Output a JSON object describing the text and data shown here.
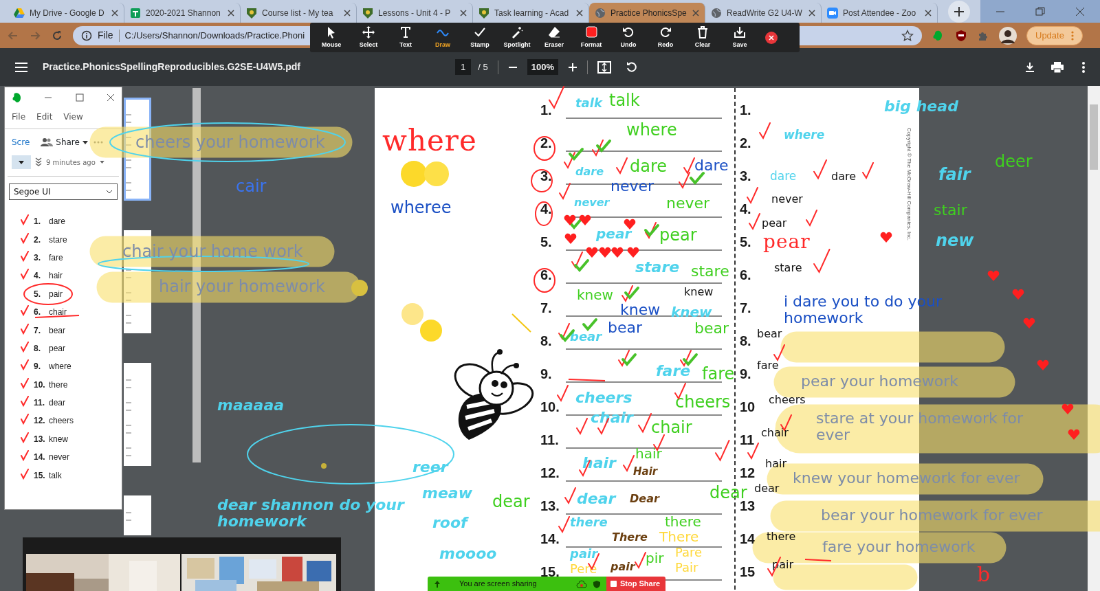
{
  "browser": {
    "tabs": [
      {
        "title": "My Drive - Google D",
        "selected": false
      },
      {
        "title": "2020-2021 Shannon",
        "selected": false
      },
      {
        "title": "Course list - My tea",
        "selected": false
      },
      {
        "title": "Lessons - Unit 4 - P",
        "selected": false
      },
      {
        "title": "Task learning - Acad",
        "selected": false
      },
      {
        "title": "Practice PhonicsSpe",
        "selected": true
      },
      {
        "title": "ReadWrite G2 U4-W",
        "selected": false
      },
      {
        "title": "Post Attendee - Zoo",
        "selected": false
      }
    ],
    "address": {
      "scheme": "File",
      "url": "C:/Users/Shannon/Downloads/Practice.Phoni"
    },
    "update_button": "Update"
  },
  "annotation_toolbar": {
    "tools": [
      {
        "label": "Mouse",
        "selected": false
      },
      {
        "label": "Select",
        "selected": false
      },
      {
        "label": "Text",
        "selected": false
      },
      {
        "label": "Draw",
        "selected": true
      },
      {
        "label": "Stamp",
        "selected": false
      },
      {
        "label": "Spotlight",
        "selected": false
      },
      {
        "label": "Eraser",
        "selected": false
      },
      {
        "label": "Format",
        "selected": false
      },
      {
        "label": "Undo",
        "selected": false
      },
      {
        "label": "Redo",
        "selected": false
      },
      {
        "label": "Clear",
        "selected": false
      },
      {
        "label": "Save",
        "selected": false
      }
    ]
  },
  "pdf_viewer": {
    "file_name": "Practice.PhonicsSpellingReproducibles.G2SE-U4W5.pdf",
    "page": "1",
    "page_count": "/ 5",
    "zoom": "100%",
    "page_thumbnails": [
      {
        "selected": true
      },
      {
        "selected": false
      },
      {
        "selected": false
      },
      {
        "selected": false
      }
    ]
  },
  "note_window": {
    "menu": [
      "File",
      "Edit",
      "View"
    ],
    "toolbar_button": "Scre",
    "share_button": "Share",
    "updated": "9 minutes ago",
    "font": "Segoe UI",
    "words": [
      {
        "number": "1.",
        "word": "dare"
      },
      {
        "number": "2.",
        "word": "stare"
      },
      {
        "number": "3.",
        "word": "fare"
      },
      {
        "number": "4.",
        "word": "hair"
      },
      {
        "number": "5.",
        "word": "pair"
      },
      {
        "number": "6.",
        "word": "chair"
      },
      {
        "number": "7.",
        "word": "bear"
      },
      {
        "number": "8.",
        "word": "pear"
      },
      {
        "number": "9.",
        "word": "where"
      },
      {
        "number": "10.",
        "word": "there"
      },
      {
        "number": "11.",
        "word": "dear"
      },
      {
        "number": "12.",
        "word": "cheers"
      },
      {
        "number": "13.",
        "word": "knew"
      },
      {
        "number": "14.",
        "word": "never"
      },
      {
        "number": "15.",
        "word": "talk"
      }
    ]
  },
  "worksheet": {
    "left_numbers": [
      "1.",
      "2.",
      "3.",
      "4.",
      "5.",
      "6.",
      "7.",
      "8.",
      "9.",
      "10.",
      "11.",
      "12.",
      "13.",
      "14.",
      "15."
    ],
    "right_numbers": [
      "1.",
      "2.",
      "3.",
      "4.",
      "5.",
      "6.",
      "7.",
      "8.",
      "9.",
      "10",
      "11",
      "12",
      "13",
      "14",
      "15"
    ],
    "copyright": "Copyright © The McGraw-Hill Companies, Inc."
  },
  "annotations": [
    {
      "text": "cheers your homework",
      "kind": "typed",
      "color": "#7d8ca8"
    },
    {
      "text": "where",
      "kind": "ink",
      "color": "#ff2a2a"
    },
    {
      "text": "cair",
      "kind": "typed",
      "color": "#3a74f0"
    },
    {
      "text": "wheree",
      "kind": "typed",
      "color": "#1a4fc4"
    },
    {
      "text": "chair your home work",
      "kind": "typed",
      "color": "#7d8ca8"
    },
    {
      "text": "hair your homework",
      "kind": "typed",
      "color": "#7d8ca8"
    },
    {
      "text": "maaaaa",
      "kind": "bold-italic",
      "color": "#4fd3ec"
    },
    {
      "text": "dear shannon do your homework",
      "kind": "bold-italic",
      "color": "#4fd3ec"
    },
    {
      "text": "reer",
      "kind": "bold-italic",
      "color": "#4fd3ec"
    },
    {
      "text": "meaw",
      "kind": "bold-italic",
      "color": "#4fd3ec"
    },
    {
      "text": "dear",
      "kind": "typed",
      "color": "#3fcf1f"
    },
    {
      "text": "roof",
      "kind": "bold-italic",
      "color": "#4fd3ec"
    },
    {
      "text": "moooo",
      "kind": "bold-italic",
      "color": "#4fd3ec"
    },
    {
      "text": "talk",
      "kind": "bold-italic",
      "color": "#4fd3ec"
    },
    {
      "text": "talk",
      "kind": "typed",
      "color": "#3fcf1f"
    },
    {
      "text": "where",
      "kind": "typed",
      "color": "#3fcf1f"
    },
    {
      "text": "dare",
      "kind": "bold-italic",
      "color": "#4fd3ec"
    },
    {
      "text": "dare",
      "kind": "typed",
      "color": "#3fcf1f"
    },
    {
      "text": "dare",
      "kind": "typed",
      "color": "#1a4fc4"
    },
    {
      "text": "never",
      "kind": "typed",
      "color": "#1a4fc4"
    },
    {
      "text": "never",
      "kind": "bold-italic",
      "color": "#4fd3ec"
    },
    {
      "text": "never",
      "kind": "typed",
      "color": "#3fcf1f"
    },
    {
      "text": "pear",
      "kind": "bold-italic",
      "color": "#4fd3ec"
    },
    {
      "text": "pear",
      "kind": "typed",
      "color": "#3fcf1f"
    },
    {
      "text": "stare",
      "kind": "bold-italic",
      "color": "#4fd3ec"
    },
    {
      "text": "stare",
      "kind": "typed",
      "color": "#3fcf1f"
    },
    {
      "text": "knew",
      "kind": "typed",
      "color": "#3fcf1f"
    },
    {
      "text": "knew",
      "kind": "typed",
      "color": "#1a4fc4"
    },
    {
      "text": "knew",
      "kind": "typed",
      "color": "#111111"
    },
    {
      "text": "knew",
      "kind": "bold-italic",
      "color": "#4fd3ec"
    },
    {
      "text": "bear",
      "kind": "typed",
      "color": "#1a4fc4"
    },
    {
      "text": "bear",
      "kind": "typed",
      "color": "#3fcf1f"
    },
    {
      "text": "bear",
      "kind": "bold-italic",
      "color": "#4fd3ec"
    },
    {
      "text": "fare",
      "kind": "bold-italic",
      "color": "#4fd3ec"
    },
    {
      "text": "fare",
      "kind": "typed",
      "color": "#3fcf1f"
    },
    {
      "text": "cheers",
      "kind": "bold-italic",
      "color": "#4fd3ec"
    },
    {
      "text": "cheers",
      "kind": "typed",
      "color": "#3fcf1f"
    },
    {
      "text": "chair",
      "kind": "bold-italic",
      "color": "#4fd3ec"
    },
    {
      "text": "chair",
      "kind": "typed",
      "color": "#3fcf1f"
    },
    {
      "text": "hair",
      "kind": "bold-italic",
      "color": "#4fd3ec"
    },
    {
      "text": "hair",
      "kind": "typed",
      "color": "#3fcf1f"
    },
    {
      "text": "Hair",
      "kind": "bold-italic",
      "color": "#6b3f10"
    },
    {
      "text": "dear",
      "kind": "bold-italic",
      "color": "#4fd3ec"
    },
    {
      "text": "Dear",
      "kind": "bold-italic",
      "color": "#6b3f10"
    },
    {
      "text": "dear",
      "kind": "typed",
      "color": "#3fcf1f"
    },
    {
      "text": "there",
      "kind": "bold-italic",
      "color": "#4fd3ec"
    },
    {
      "text": "There",
      "kind": "bold-italic",
      "color": "#6b3f10"
    },
    {
      "text": "there",
      "kind": "typed",
      "color": "#3fcf1f"
    },
    {
      "text": "There",
      "kind": "typed",
      "color": "#ffd83a"
    },
    {
      "text": "pair",
      "kind": "bold-italic",
      "color": "#4fd3ec"
    },
    {
      "text": "Pere",
      "kind": "typed",
      "color": "#ffd83a"
    },
    {
      "text": "pair",
      "kind": "bold-italic",
      "color": "#6b3f10"
    },
    {
      "text": "pir",
      "kind": "typed",
      "color": "#3fcf1f"
    },
    {
      "text": "Pare",
      "kind": "typed",
      "color": "#ffd83a"
    },
    {
      "text": "Pair",
      "kind": "typed",
      "color": "#ffd83a"
    },
    {
      "text": "big head",
      "kind": "bold-italic",
      "color": "#4fd3ec"
    },
    {
      "text": "where",
      "kind": "bold-italic",
      "color": "#4fd3ec"
    },
    {
      "text": "dare",
      "kind": "typed",
      "color": "#4fd3ec"
    },
    {
      "text": "dare",
      "kind": "typed",
      "color": "#111111"
    },
    {
      "text": "never",
      "kind": "typed",
      "color": "#111111"
    },
    {
      "text": "pear",
      "kind": "typed",
      "color": "#111111"
    },
    {
      "text": "pear",
      "kind": "ink",
      "color": "#ff2a2a"
    },
    {
      "text": "stare",
      "kind": "typed",
      "color": "#111111"
    },
    {
      "text": "i dare you to do your homework",
      "kind": "typed",
      "color": "#1a4fc4"
    },
    {
      "text": "bear",
      "kind": "typed",
      "color": "#111111"
    },
    {
      "text": "fare",
      "kind": "typed",
      "color": "#111111"
    },
    {
      "text": "pear your homework",
      "kind": "typed",
      "color": "#7d8ca8"
    },
    {
      "text": "cheers",
      "kind": "typed",
      "color": "#111111"
    },
    {
      "text": "chair",
      "kind": "typed",
      "color": "#111111"
    },
    {
      "text": "stare at your homework for ever",
      "kind": "typed",
      "color": "#7d8ca8"
    },
    {
      "text": "hair",
      "kind": "typed",
      "color": "#111111"
    },
    {
      "text": "knew your homework for ever",
      "kind": "typed",
      "color": "#7d8ca8"
    },
    {
      "text": "dear",
      "kind": "typed",
      "color": "#111111"
    },
    {
      "text": "bear your homework for ever",
      "kind": "typed",
      "color": "#7d8ca8"
    },
    {
      "text": "there",
      "kind": "typed",
      "color": "#111111"
    },
    {
      "text": "fare your homework",
      "kind": "typed",
      "color": "#7d8ca8"
    },
    {
      "text": "pair",
      "kind": "typed",
      "color": "#111111"
    },
    {
      "text": "deer",
      "kind": "typed",
      "color": "#3fcf1f"
    },
    {
      "text": "fair",
      "kind": "bold-italic",
      "color": "#4fd3ec"
    },
    {
      "text": "stair",
      "kind": "typed",
      "color": "#3fcf1f"
    },
    {
      "text": "new",
      "kind": "bold-italic",
      "color": "#4fd3ec"
    },
    {
      "text": "b",
      "kind": "ink",
      "color": "#ff2a2a"
    }
  ],
  "share_bar": {
    "status": "You are screen sharing",
    "stop_button": "Stop Share"
  }
}
